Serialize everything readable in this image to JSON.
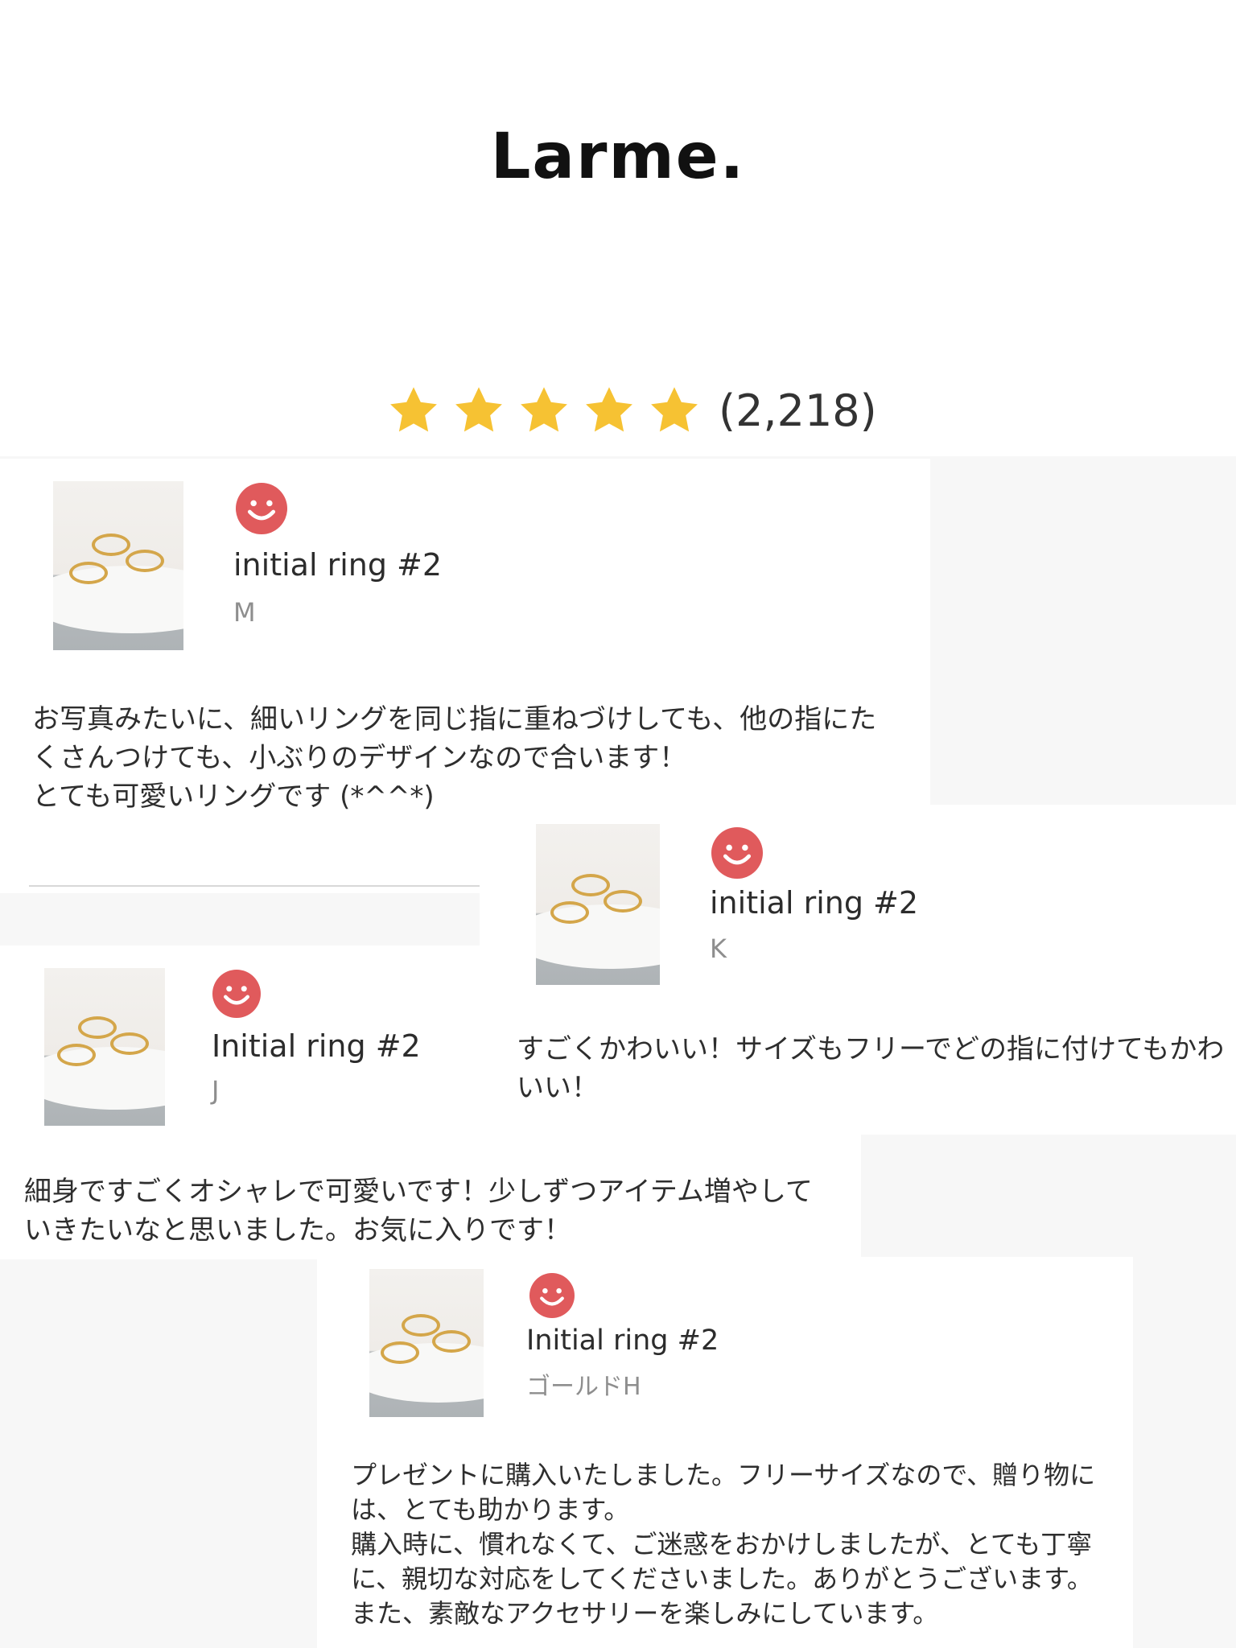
{
  "brand": {
    "logo_text": "Larme."
  },
  "rating": {
    "stars": 5,
    "max_stars": 5,
    "count_text": "(2,218)",
    "star_color": "#f6c233"
  },
  "smile_color": "#e05a5c",
  "ring_color": "#d4a64a",
  "reviews": [
    {
      "product": "initial ring #2",
      "variant": "M",
      "text": "お写真みたいに、細いリングを同じ指に重ねづけしても、他の指にたくさんつけても、小ぶりのデザインなので合います！\nとても可愛いリングです (*^^*)"
    },
    {
      "product": "initial ring #2",
      "variant": "K",
      "text": "すごくかわいい！サイズもフリーでどの指に付けてもかわいい！"
    },
    {
      "product": "Initial ring #2",
      "variant": "J",
      "text": "細身ですごくオシャレで可愛いです！少しずつアイテム増やしていきたいなと思いました。お気に入りです！"
    },
    {
      "product": "Initial ring #2",
      "variant": "ゴールドH",
      "text": "プレゼントに購入いたしました。フリーサイズなので、贈り物には、とても助かります。\n購入時に、慣れなくて、ご迷惑をおかけしましたが、とても丁寧に、親切な対応をしてくださいました。ありがとうございます。また、素敵なアクセサリーを楽しみにしています。"
    }
  ]
}
